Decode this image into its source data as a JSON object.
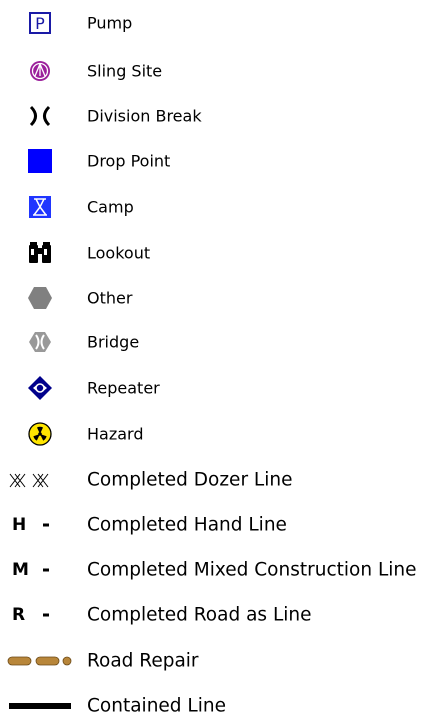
{
  "legend": {
    "items": [
      {
        "label": "Pump",
        "icon": "pump-icon"
      },
      {
        "label": "Sling Site",
        "icon": "sling-site-icon"
      },
      {
        "label": "Division Break",
        "icon": "division-break-icon"
      },
      {
        "label": "Drop Point",
        "icon": "drop-point-icon"
      },
      {
        "label": "Camp",
        "icon": "camp-icon"
      },
      {
        "label": "Lookout",
        "icon": "lookout-icon"
      },
      {
        "label": "Other",
        "icon": "other-icon"
      },
      {
        "label": "Bridge",
        "icon": "bridge-icon"
      },
      {
        "label": "Repeater",
        "icon": "repeater-icon"
      },
      {
        "label": "Hazard",
        "icon": "hazard-icon"
      },
      {
        "label": "Completed Dozer Line",
        "icon": "dozer-line-icon"
      },
      {
        "label": "Completed Hand Line",
        "icon": "hand-line-icon",
        "symbol_text": "H"
      },
      {
        "label": "Completed Mixed Construction Line",
        "icon": "mixed-line-icon",
        "symbol_text": "M"
      },
      {
        "label": "Completed Road as Line",
        "icon": "road-line-icon",
        "symbol_text": "R"
      },
      {
        "label": "Road Repair",
        "icon": "road-repair-icon"
      },
      {
        "label": "Contained Line",
        "icon": "contained-line-icon"
      }
    ]
  },
  "colors": {
    "pump": "#1a1aa6",
    "sling_site": "#9b1f9b",
    "drop_point": "#0000ff",
    "camp": "#1f35ff",
    "other": "#808080",
    "bridge": "#999999",
    "repeater": "#00008b",
    "hazard": "#ffe600",
    "road_repair": "#b8863a",
    "line": "#000000"
  }
}
